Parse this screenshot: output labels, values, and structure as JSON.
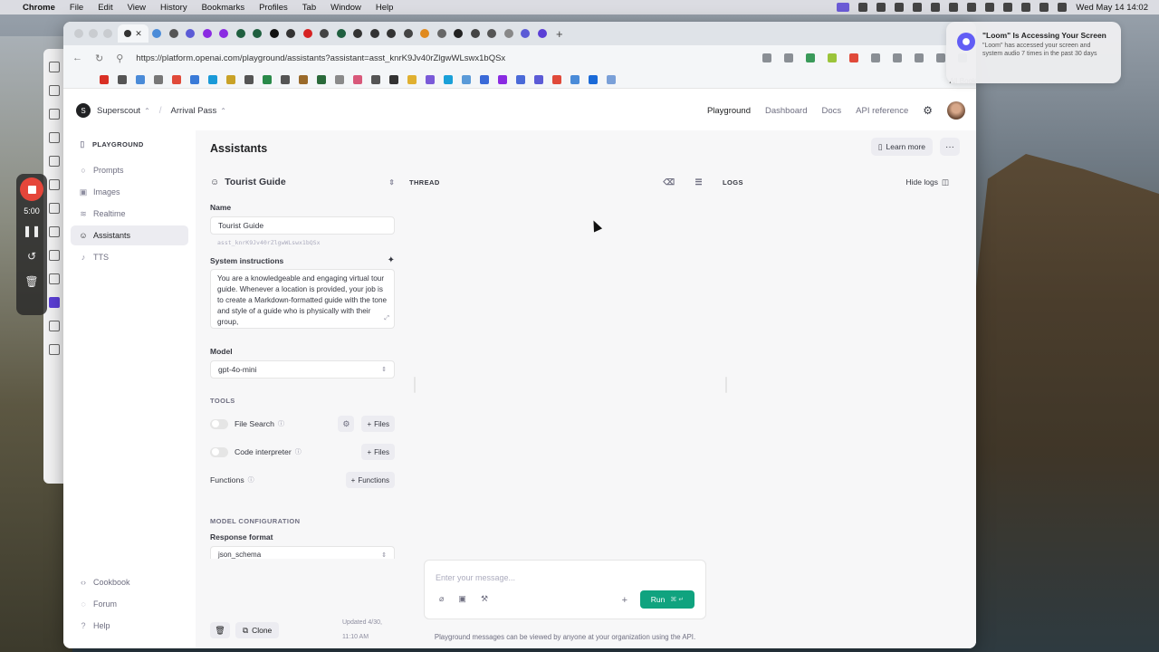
{
  "menubar": {
    "app": "Chrome",
    "items": [
      "File",
      "Edit",
      "View",
      "History",
      "Bookmarks",
      "Profiles",
      "Tab",
      "Window",
      "Help"
    ],
    "datetime": "Wed May 14  14:02"
  },
  "loom": {
    "timer": "5:00"
  },
  "notification": {
    "title": "\"Loom\" Is Accessing Your Screen",
    "body": "\"Loom\" has accessed your screen and system audio 7 times in the past 30 days"
  },
  "browser": {
    "url": "https://platform.openai.com/playground/assistants?assistant=asst_knrK9Jv40rZlgwWLswx1bQSx",
    "all_bookmarks": "All Book"
  },
  "topnav": {
    "org_initial": "S",
    "org": "Superscout",
    "project": "Arrival Pass",
    "links": [
      "Playground",
      "Dashboard",
      "Docs",
      "API reference"
    ]
  },
  "sidebar": {
    "heading": "PLAYGROUND",
    "items": [
      {
        "label": "Prompts",
        "icon": "chat-bubble-icon"
      },
      {
        "label": "Images",
        "icon": "image-icon"
      },
      {
        "label": "Realtime",
        "icon": "waveform-icon"
      },
      {
        "label": "Assistants",
        "icon": "robot-icon"
      },
      {
        "label": "TTS",
        "icon": "microphone-icon"
      }
    ],
    "bottom": [
      {
        "label": "Cookbook",
        "icon": "code-icon"
      },
      {
        "label": "Forum",
        "icon": "forum-icon"
      },
      {
        "label": "Help",
        "icon": "help-icon"
      }
    ]
  },
  "main": {
    "title": "Assistants",
    "learn_more": "Learn more",
    "assistant_name_header": "Tourist Guide",
    "name_label": "Name",
    "name_value": "Tourist Guide",
    "assistant_id": "asst_knrK9Jv40rZlgwWLswx1bQSx",
    "system_label": "System instructions",
    "system_text": "You are a knowledgeable and engaging virtual tour guide. Whenever a location is provided, your job is to create a Markdown-formatted guide with the tone and style of a guide who is physically with their group,",
    "model_label": "Model",
    "model_value": "gpt-4o-mini",
    "tools_label": "TOOLS",
    "file_search": "File Search",
    "code_interpreter": "Code interpreter",
    "functions_label": "Functions",
    "files_btn": "Files",
    "functions_btn": "Functions",
    "model_config_label": "MODEL CONFIGURATION",
    "response_format_label": "Response format",
    "response_format_value": "json_schema",
    "clone": "Clone",
    "updated": "Updated 4/30, 11:10 AM"
  },
  "thread": {
    "label": "THREAD",
    "logs_label": "LOGS",
    "hide_logs": "Hide logs",
    "placeholder": "Enter your message...",
    "run": "Run",
    "run_kbd": "⌘ ↵",
    "footnote": "Playground messages can be viewed by anyone at your organization using the API."
  },
  "colors": {
    "accent": "#10a37f",
    "loom_red": "#e5463a"
  }
}
